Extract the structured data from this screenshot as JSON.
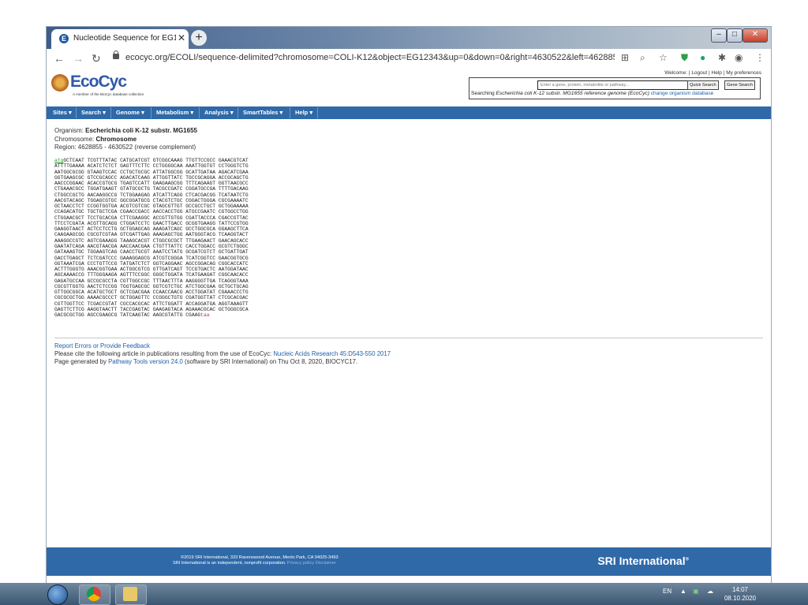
{
  "browser": {
    "tab_title": "Nucleotide Sequence for EG12343",
    "tab_favicon": "E",
    "url": "ecocyc.org/ECOLI/sequence-delimited?chromosome=COLI-K12&object=EG12343&up=0&down=0&right=4630522&left=4628855&type..."
  },
  "header": {
    "logo_text": "EcoCyc",
    "logo_tagline": "A member of the BioCyc database collection",
    "welcome": "Welcome:",
    "logout": "Logout",
    "help": "Help",
    "preferences": "My preferences",
    "search_placeholder": "Enter a gene, protein, metabolite or pathway...",
    "quick_search": "Quick Search",
    "gene_search": "Gene Search",
    "searching_prefix": "Searching ",
    "searching_org": "Escherichia coli K-12 substr. MG1655 reference genome (EcoCyc)",
    "change_db": "change organism database"
  },
  "menu": [
    "Sites ▾",
    "Search ▾",
    "Genome ▾",
    "Metabolism ▾",
    "Analysis ▾",
    "SmartTables ▾",
    "Help ▾"
  ],
  "info": {
    "organism_label": "Organism:",
    "organism": "Escherichia coli K-12 substr. MG1655",
    "chromosome_label": "Chromosome:",
    "chromosome": "Chromosome",
    "region": "Region: 4628855 - 4630522 (reverse complement)"
  },
  "sequence": {
    "start_codon": "atg",
    "first_line_rest": "GCTCAAT TCGTTTATAC CATGCATCGT GTCGGCAAAG TTGTTCCGCC GAAACGTCAT",
    "lines": [
      "ATTTTGAAAA ACATCTCTCT GAGTTTCTTC CCTGGGGCAA AAATTGGTGT CCTGGGTCTG",
      "AATGGCGCGG GTAAGTCCAC CCTGCTGCGC ATTATGGCGG GCATTGATAA AGACATCGAA",
      "GGTGAAGCGC GTCCGCAGCC AGACATCAAG ATTGGTTATC TGCCGCAGGA ACCGCAGCTG",
      "AACCCGGAAC ACACCGTGCG TGAGTCCATT GAAGAAGCGG TTTCAGAAGT GGTTAACGCC",
      "CTGAAACGCC TGGATGAAGT GTATGCGCTG TACGCCGATC CGGATGCCGA TTTTGACAAG",
      "CTGGCCGCTG AACAAGGCCG TCTGGAAGAG ATCATTCAGG CTCACGACGG TCATAATCTG",
      "AACGTACAGC TGGAGCGTGC GGCGGATGCG CTACGTCTGC CGGACTGGGA CGCGAAAATC",
      "GCTAACCTCT CCGGTGGTGA ACGTCGTCGC GTAGCGTTGT GCCGCCTGCT GCTGGAAAAA",
      "CCAGACATGC TGCTGCTCGA CGAACCGACC AACCACCTGG ATGCCGAATC CGTGGCCTGG",
      "CTGGAACGCT TCCTGCACGA CTTCGAAGGC ACCGTTGTGG CGATTACCCA CGACCGTTAC",
      "TTCCTCGATA ACGTTGCAGG CTGGATCCTC GAACTTGACC GCGGTGAAGG TATTCCGTGG",
      "GAAGGTAACT ACTCCTCCTG GCTGGAGCAG AAAGATCAGC GCCTGGCGCA GGAAGCTTCA",
      "CAAGAAGCGG CGCGTCGTAA GTCGATTGAG AAAGAGCTGG AATGGGTACG TCAAGGTACT",
      "AAAGGCCGTC AGTCGAAAGG TAAAGCACGT CTGGCGCGCT TTGAAGAACT GAACAGCACC",
      "GAATATCAGA AACGTAACGA AACCAACGAA CTGTTTATTC CACCTGGACC GCGTCTGGGC",
      "GATAAAGTGC TGGAAGTCAG CAACCTGCGT AAATCCTATG GCGATCGTCT GCTGATTGAT",
      "GACCTGAGCT TCTCGATCCC GAAAGGAGCG ATCGTCGGGA TCATCGGTCC GAACGGTGCG",
      "GGTAAATCGA CCCTGTTCCG TATGATCTCT GGTCAGGAAC AGCCGGACAG CGGCACCATC",
      "ACTTTGGGTG AAACGGTGAA ACTGGCGTCG GTTGATCAGT TCCGTGACTC AATGGATAAC",
      "AGCAAAACCG TTTGGGAAGA AGTTTCCGGC GGGCTGGATA TCATGAAGAT CGGCAACACC",
      "GAGATGCCAA GCCGCGCCTA CGTTGGCCGC TTTAACTTTA AAGGGGTTGA TCAGGGTAAA",
      "CGCGTTGGTG AACTCTCCGG TGGTGAGCGC GGTCGTCTGC ATCTGGCGAA GCTGCTGCAG",
      "GTTGGCGGCA ACATGCTGCT GCTCGACGAA CCAACCAACG ACCTGGATAT CGAAACCCTG",
      "CGCGCGCTGG AAAACGCCCT GCTGGAGTTC CCGGGCTGTG CGATGGTTAT CTCGCACGAC",
      "CGTTGGTTCC TCGACCGTAT CGCCACGCAC ATTCTGGATT ACCAGGATGA AGGTAAAGTT",
      "GAGTTCTTCG AAGGTAACTT TACCGAGTAC GAAGAGTACA AGAAACGCAC GCTGGGCGCA"
    ],
    "last_line_rest": "GACGCGCTGG AGCCGAAGCG TATCAAGTAC AAGCGTATTG CGAAG",
    "stop_codon": "taa"
  },
  "feedback": {
    "report": "Report Errors or Provide Feedback",
    "cite_prefix": "Please cite the following article in publications resulting from the use of EcoCyc: ",
    "cite_link": "Nucleic Acids Research 45:D543-550 2017",
    "generated_prefix": "Page generated by ",
    "generated_link": "Pathway Tools version 24.0",
    "generated_suffix": " (software by SRI International) on Thu Oct 8, 2020, BIOCYC17."
  },
  "footer": {
    "address": "©2019 SRI International, 333 Ravenswood Avenue, Menlo Park, CA 94025-3493",
    "line2": "SRI International is an independent, nonprofit corporation.",
    "privacy": "Privacy policy",
    "disclaimer": "Disclaimer",
    "brand": "SRI International"
  },
  "taskbar": {
    "lang": "EN",
    "time": "14:07",
    "date": "08.10.2020"
  },
  "colors": {
    "menu_blue": "#2f69a8",
    "link_blue": "#1d5fa8",
    "start_codon": "#2a9a2a",
    "stop_codon": "#c0392b"
  }
}
